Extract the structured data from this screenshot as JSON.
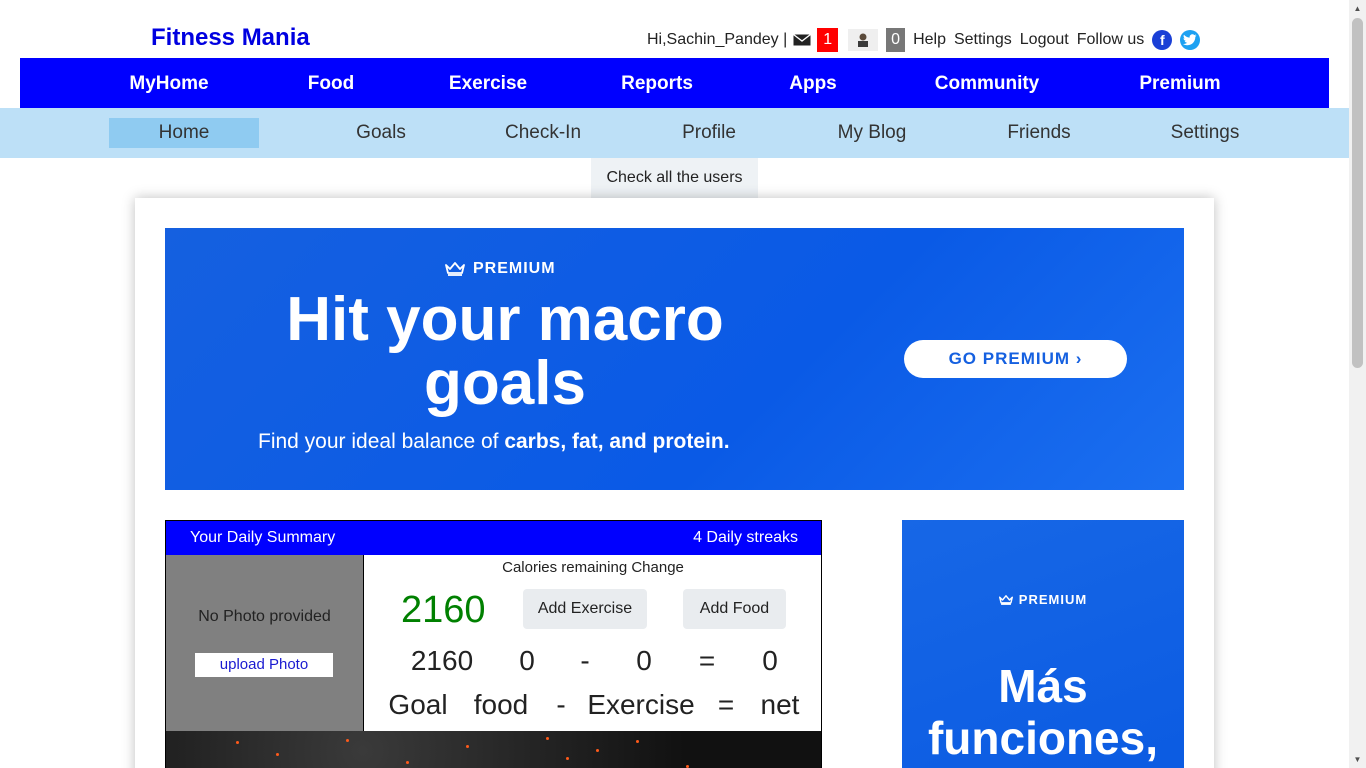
{
  "brand": "Fitness Mania",
  "topbar": {
    "greeting": "Hi,Sachin_Pandey |",
    "mail_count": "1",
    "notif_count": "0",
    "links": [
      "Help",
      "Settings",
      "Logout",
      "Follow us"
    ],
    "facebook": "f"
  },
  "mainnav": [
    "MyHome",
    "Food",
    "Exercise",
    "Reports",
    "Apps",
    "Community",
    "Premium"
  ],
  "subnav": [
    "Home",
    "Goals",
    "Check-In",
    "Profile",
    "My Blog",
    "Friends",
    "Settings"
  ],
  "dropdown": "Check all the users",
  "banner": {
    "badge": "PREMIUM",
    "headline": "Hit your macro goals",
    "sub_prefix": "Find your ideal balance of ",
    "sub_bold": "carbs, fat, and protein.",
    "cta": "GO PREMIUM ›"
  },
  "summary": {
    "title": "Your Daily Summary",
    "streak": "4 Daily streaks",
    "no_photo": "No Photo provided",
    "upload": "upload Photo",
    "calories_label": "Calories remaining Change",
    "calories_remaining": "2160",
    "add_exercise": "Add Exercise",
    "add_food": "Add Food",
    "row_values": [
      "2160",
      "0",
      "-",
      "0",
      "=",
      "0"
    ],
    "row_labels": [
      "Goal",
      "food",
      "-",
      "Exercise",
      "=",
      "net"
    ]
  },
  "sidead": {
    "badge": "PREMIUM",
    "headline": "Más funciones,"
  },
  "colors": {
    "brand": "#0000e0",
    "mainnav_bg": "#0000ff",
    "subnav_bg": "#bde0f7",
    "subnav_active": "#8fcbf1",
    "banner_blue": "#0a5ae6",
    "calories_green": "#008000",
    "badge_red": "#ff0000"
  },
  "icons": [
    "mail-icon",
    "avatar-icon",
    "facebook-icon",
    "twitter-icon",
    "crown-icon"
  ]
}
